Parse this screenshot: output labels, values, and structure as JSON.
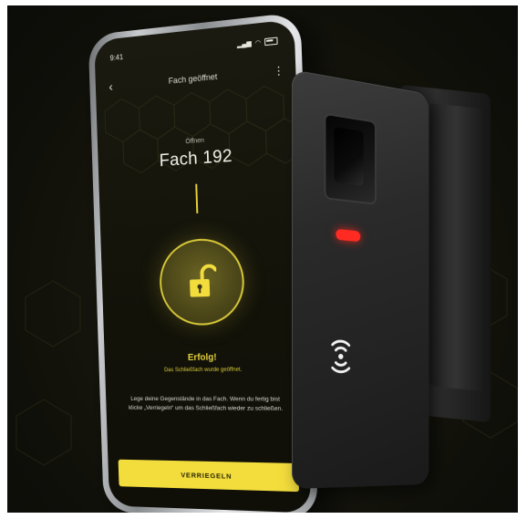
{
  "status_bar": {
    "time": "9:41"
  },
  "nav": {
    "title": "Fach geöffnet"
  },
  "compartment": {
    "label": "Öffnen",
    "name": "Fach 192"
  },
  "result": {
    "title": "Erfolg!",
    "subtitle": "Das Schließfach wurde geöffnet.",
    "instruction": "Lege deine Gegenstände in das Fach. Wenn du fertig bist klicke „Verriegeln“ um das Schließfach wieder zu schließen."
  },
  "actions": {
    "lock_button": "VERRIEGELN"
  },
  "colors": {
    "accent": "#f3dd3c",
    "led": "#ff2a22",
    "background": "#121209"
  },
  "icons": [
    "back-icon",
    "more-icon",
    "unlocked-padlock-icon",
    "nfc-icon",
    "fingerprint-sensor"
  ]
}
